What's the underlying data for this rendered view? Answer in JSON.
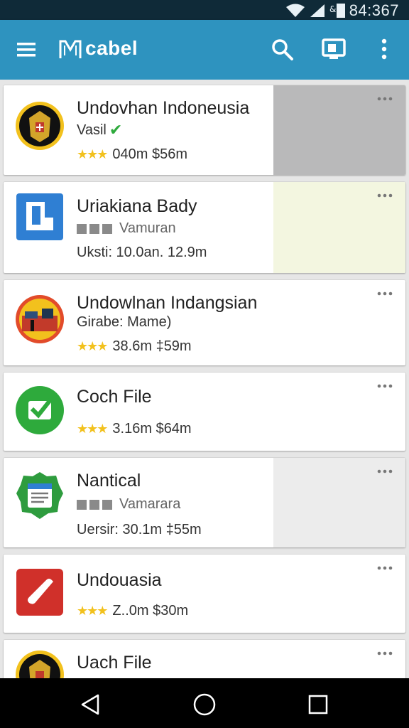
{
  "status_bar": {
    "time": "84:367",
    "icons": [
      "wifi-icon",
      "signal-icon",
      "battery-icon"
    ]
  },
  "app_bar": {
    "title": "cabel",
    "icons": [
      "menu-icon",
      "logo-icon",
      "search-icon",
      "cast-icon",
      "more-vert-icon"
    ]
  },
  "colors": {
    "app_bar": "#2e93bf",
    "status_bar": "#0f2a38",
    "stars": "#f2c11d",
    "check": "#2eaa3c"
  },
  "items": [
    {
      "name": "Undovhan Indoneusia",
      "line1": "Vasil",
      "line1_check": "✔",
      "stars": "★★★",
      "line2": "040m $56m",
      "icon": "emblem-icon",
      "accent": "#b9b9ba"
    },
    {
      "name": "Uriakiana Bady",
      "line1": "Vamuran",
      "line2": "Uksti: 10.0an. 12.9m",
      "icon": "docs-icon",
      "accent": "#f3f6e0"
    },
    {
      "name": "Undowlnan Indangsian",
      "line1": "Girabe: Mame)",
      "stars": "★★★",
      "line2": "38.6m ‡59m",
      "icon": "city-icon"
    },
    {
      "name": "Coch File",
      "stars": "★★★",
      "line2": "3.16m $64m",
      "icon": "check-icon"
    },
    {
      "name": "Nantical",
      "line1": "Vamarara",
      "line2": "Uersir: 30.1m ‡55m",
      "icon": "notes-icon",
      "accent": "#ececec"
    },
    {
      "name": "Undouasia",
      "stars": "★★★",
      "line2": "Z..0m $30m",
      "icon": "phone-icon"
    },
    {
      "name": "Uach File",
      "icon": "emblem-icon"
    }
  ],
  "nav": [
    "back-icon",
    "home-icon",
    "recents-icon"
  ]
}
